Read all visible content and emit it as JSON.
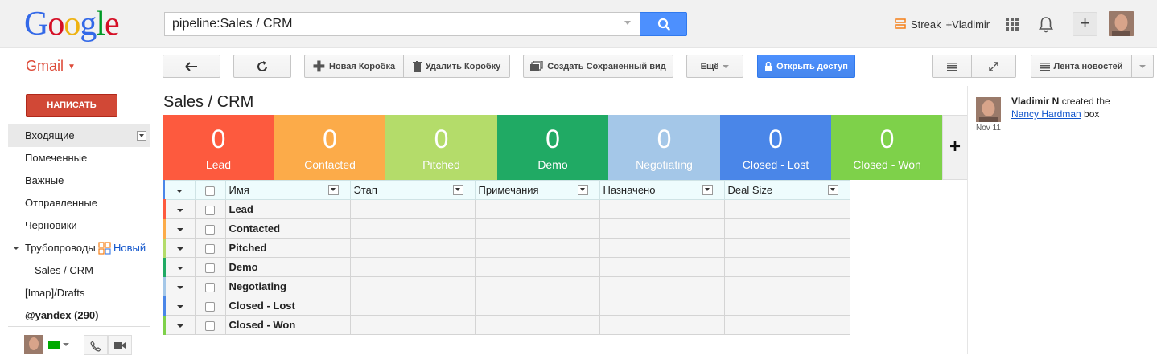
{
  "header": {
    "logo": [
      "G",
      "o",
      "o",
      "g",
      "l",
      "e"
    ],
    "logo_colors": [
      "#3369e8",
      "#d50f25",
      "#eeb211",
      "#3369e8",
      "#009925",
      "#d50f25"
    ],
    "search_value": "pipeline:Sales / CRM",
    "streak_label": "Streak",
    "account_label": "+Vladimir"
  },
  "toolbar": {
    "back_icon": "back-arrow-icon",
    "refresh_icon": "refresh-icon",
    "new_box": "Новая Коробка",
    "delete_box": "Удалить Коробку",
    "save_view": "Создать Сохраненный вид",
    "more": "Ещё",
    "share": "Открыть доступ",
    "newsfeed": "Лента новостей"
  },
  "sidebar": {
    "app_name": "Gmail",
    "compose": "НАПИСАТЬ",
    "items": [
      {
        "label": "Входящие"
      },
      {
        "label": "Помеченные"
      },
      {
        "label": "Важные"
      },
      {
        "label": "Отправленные"
      },
      {
        "label": "Черновики"
      },
      {
        "label": "Трубопроводы"
      },
      {
        "label": "Sales / CRM"
      },
      {
        "label": "[Imap]/Drafts"
      },
      {
        "label": "@yandex (290)"
      }
    ],
    "new_pipeline": "Новый"
  },
  "pipeline": {
    "title": "Sales / CRM",
    "stages": [
      {
        "count": "0",
        "name": "Lead",
        "color": "#fd5a3e"
      },
      {
        "count": "0",
        "name": "Contacted",
        "color": "#fcab49"
      },
      {
        "count": "0",
        "name": "Pitched",
        "color": "#b4dc6a"
      },
      {
        "count": "0",
        "name": "Demo",
        "color": "#20aa64"
      },
      {
        "count": "0",
        "name": "Negotiating",
        "color": "#a4c7e8"
      },
      {
        "count": "0",
        "name": "Closed - Lost",
        "color": "#4a86e8"
      },
      {
        "count": "0",
        "name": "Closed - Won",
        "color": "#7ed14a"
      }
    ],
    "add_stage": "+",
    "columns": [
      "Имя",
      "Этап",
      "Примечания",
      "Назначено",
      "Deal Size"
    ],
    "rows": [
      "Lead",
      "Contacted",
      "Pitched",
      "Demo",
      "Negotiating",
      "Closed - Lost",
      "Closed - Won"
    ]
  },
  "feed": {
    "author": "Vladimir N",
    "action": " created the",
    "target": "Nancy Hardman",
    "suffix": " box",
    "date": "Nov 11"
  }
}
